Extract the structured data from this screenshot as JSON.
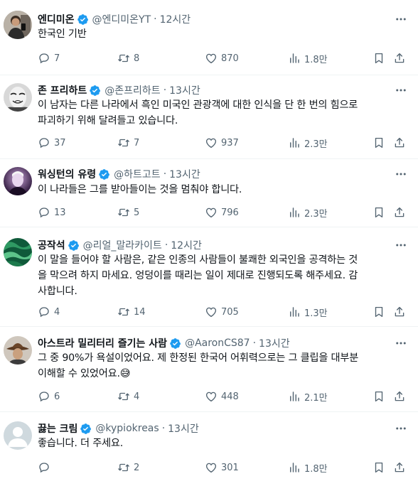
{
  "tweets": [
    {
      "name": "엔디미온",
      "handle": "@엔디미온YT",
      "time": "12시간",
      "lines": [
        "한국인 기반"
      ],
      "replies": "7",
      "retweets": "8",
      "likes": "870",
      "views": "1.8만",
      "avatar_icon": "profile-photo-man-mirror-selfie"
    },
    {
      "name": "존 프리하트",
      "handle": "@존프리하트",
      "time": "13시간",
      "lines": [
        "이 남자는 다른 나라에서 흑인 미국인 관광객에 대한 인식을 단 한 번의 힘으로",
        "파괴하기 위해 달려들고 있습니다."
      ],
      "replies": "37",
      "retweets": "7",
      "likes": "937",
      "views": "2.3만",
      "avatar_icon": "profile-photo-mask"
    },
    {
      "name": "워싱턴의 유령",
      "handle": "@하트고트",
      "time": "13시간",
      "lines": [
        "이 나라들은 그를 받아들이는 것을 멈춰야 합니다."
      ],
      "replies": "13",
      "retweets": "5",
      "likes": "796",
      "views": "2.3만",
      "avatar_icon": "profile-photo-purple-portrait"
    },
    {
      "name": "공작석",
      "handle": "@리얼_말라카이트",
      "time": "12시간",
      "lines": [
        "이 말을 들어야 할 사람은, 같은 인종의 사람들이 불쾌한 외국인을 공격하는 것",
        "을 막으려 하지 마세요. 엉덩이를 때리는 일이 제대로 진행되도록 해주세요. 감",
        "사합니다."
      ],
      "replies": "4",
      "retweets": "14",
      "likes": "705",
      "views": "1.3만",
      "avatar_icon": "profile-photo-malachite"
    },
    {
      "name": "아스트라 밀리터리 즐기는 사람",
      "handle": "@AaronCS87",
      "time": "13시간",
      "lines": [
        "그 중 90%가 욕설이었어요. 제 한정된 한국어 어휘력으로는 그 클립을 대부분",
        "이해할 수 있었어요."
      ],
      "emoji": "😅",
      "replies": "6",
      "retweets": "4",
      "likes": "448",
      "views": "2.1만",
      "avatar_icon": "profile-photo-cowboy-hat"
    },
    {
      "name": "끓는 크림",
      "handle": "@kypiokreas",
      "time": "13시간",
      "lines": [
        "좋습니다. 더 주세요."
      ],
      "replies": "",
      "retweets": "2",
      "likes": "301",
      "views": "1.8만",
      "avatar_icon": "default-profile-icon"
    }
  ],
  "colors": {
    "verified": "#1d9bf0",
    "text": "#0f1419",
    "secondary": "#536471",
    "divider": "#eff3f4"
  }
}
